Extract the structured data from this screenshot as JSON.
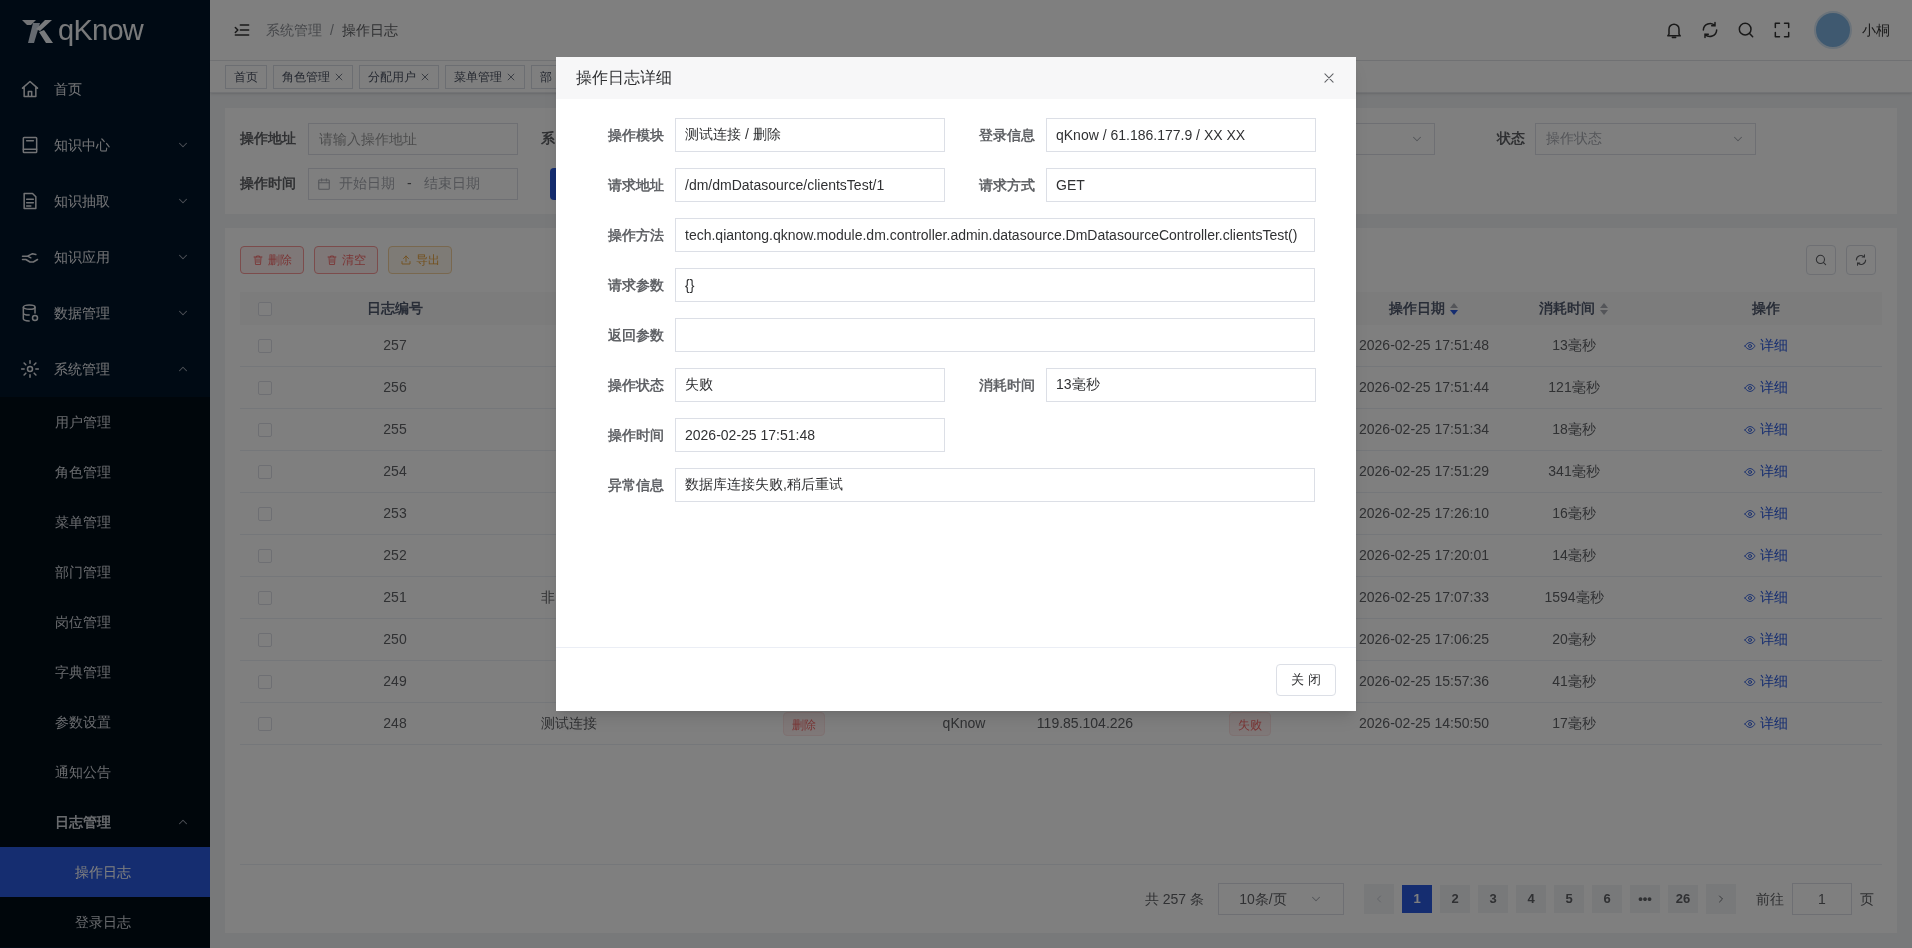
{
  "app": {
    "logo_text": "qKnow"
  },
  "sidebar": {
    "items": [
      {
        "label": "首页",
        "selected": false
      },
      {
        "label": "知识中心",
        "selected": false,
        "expanded": false
      },
      {
        "label": "知识抽取",
        "selected": false,
        "expanded": false
      },
      {
        "label": "知识应用",
        "selected": false,
        "expanded": false
      },
      {
        "label": "数据管理",
        "selected": false,
        "expanded": false
      },
      {
        "label": "系统管理",
        "selected": false,
        "expanded": true,
        "children": [
          {
            "label": "用户管理",
            "selected": false
          },
          {
            "label": "角色管理",
            "selected": false
          },
          {
            "label": "菜单管理",
            "selected": false
          },
          {
            "label": "部门管理",
            "selected": false
          },
          {
            "label": "岗位管理",
            "selected": false
          },
          {
            "label": "字典管理",
            "selected": false
          },
          {
            "label": "参数设置",
            "selected": false
          },
          {
            "label": "通知公告",
            "selected": false
          },
          {
            "label": "日志管理",
            "selected": false,
            "expanded": true,
            "children": [
              {
                "label": "操作日志",
                "selected": true
              },
              {
                "label": "登录日志",
                "selected": false
              }
            ]
          }
        ]
      }
    ]
  },
  "header": {
    "breadcrumb": [
      "系统管理",
      "操作日志"
    ],
    "breadcrumb_separator": "/",
    "user_name": "小桐"
  },
  "tabs": [
    {
      "label": "首页",
      "selected": false,
      "closable": false
    },
    {
      "label": "角色管理",
      "selected": false,
      "closable": true
    },
    {
      "label": "分配用户",
      "selected": false,
      "closable": true
    },
    {
      "label": "菜单管理",
      "selected": false,
      "closable": true
    },
    {
      "label": "部",
      "selected": false,
      "closable": false
    }
  ],
  "filters": {
    "address_label": "操作地址",
    "address_placeholder": "请输入操作地址",
    "column_2_label": "系",
    "status_label": "状态",
    "status_placeholder": "操作状态",
    "time_label": "操作时间",
    "start_placeholder": "开始日期",
    "range_separator": "-",
    "end_placeholder": "结束日期"
  },
  "toolbar": [
    {
      "label": "删除",
      "kind": "danger"
    },
    {
      "label": "清空",
      "kind": "danger"
    },
    {
      "label": "导出",
      "kind": "warning"
    }
  ],
  "table": {
    "select_all_checked": false,
    "columns": [
      {
        "label": "日志编号",
        "sortable": false
      },
      {
        "label": "操作日期",
        "sortable": true,
        "sorted_descending": true
      },
      {
        "label": "消耗时间",
        "sortable": true,
        "sorted_descending": false
      },
      {
        "label": "操作",
        "sortable": false
      }
    ],
    "rows": [
      {
        "checked": false,
        "log_id": "257",
        "date": "2026-02-25 17:51:48",
        "duration": "13毫秒",
        "action": "详细"
      },
      {
        "checked": false,
        "log_id": "256",
        "date": "2026-02-25 17:51:44",
        "duration": "121毫秒",
        "action": "详细"
      },
      {
        "checked": false,
        "log_id": "255",
        "date": "2026-02-25 17:51:34",
        "duration": "18毫秒",
        "action": "详细"
      },
      {
        "checked": false,
        "log_id": "254",
        "date": "2026-02-25 17:51:29",
        "duration": "341毫秒",
        "action": "详细"
      },
      {
        "checked": false,
        "log_id": "253",
        "date": "2026-02-25 17:26:10",
        "duration": "16毫秒",
        "action": "详细"
      },
      {
        "checked": false,
        "log_id": "252",
        "date": "2026-02-25 17:20:01",
        "duration": "14毫秒",
        "action": "详细"
      },
      {
        "checked": false,
        "log_id": "251",
        "column_2": "非",
        "date": "2026-02-25 17:07:33",
        "duration": "1594毫秒",
        "action": "详细"
      },
      {
        "checked": false,
        "log_id": "250",
        "date": "2026-02-25 17:06:25",
        "duration": "20毫秒",
        "action": "详细"
      },
      {
        "checked": false,
        "log_id": "249",
        "date": "2026-02-25 15:57:36",
        "duration": "41毫秒",
        "action": "详细"
      },
      {
        "checked": false,
        "log_id": "248",
        "column_2": "测试连接",
        "column_3": "删除",
        "column_4": "qKnow",
        "column_5": "119.85.104.226",
        "column_6": "失败",
        "date": "2026-02-25 14:50:50",
        "duration": "17毫秒",
        "action": "详细"
      }
    ]
  },
  "pagination": {
    "total": "共 257 条",
    "page_size": "10条/页",
    "pages": [
      {
        "label": "1",
        "selected": true
      },
      {
        "label": "2",
        "selected": false
      },
      {
        "label": "3",
        "selected": false
      },
      {
        "label": "4",
        "selected": false
      },
      {
        "label": "5",
        "selected": false
      },
      {
        "label": "6",
        "selected": false
      },
      {
        "label": "•••",
        "selected": false
      },
      {
        "label": "26",
        "selected": false
      }
    ],
    "goto_label": "前往",
    "goto_value": "1",
    "page_suffix": "页"
  },
  "dialog": {
    "title": "操作日志详细",
    "close_button": "关 闭",
    "fields": [
      {
        "label": "操作模块",
        "value": "测试连接 / 删除",
        "kind": "half"
      },
      {
        "label": "登录信息",
        "value": "qKnow / 61.186.177.9 / XX XX",
        "kind": "half"
      },
      {
        "label": "请求地址",
        "value": "/dm/dmDatasource/clientsTest/1",
        "kind": "half"
      },
      {
        "label": "请求方式",
        "value": "GET",
        "kind": "half"
      },
      {
        "label": "操作方法",
        "value": "tech.qiantong.qknow.module.dm.controller.admin.datasource.DmDatasourceController.clientsTest()",
        "kind": "full"
      },
      {
        "label": "请求参数",
        "value": "{}",
        "kind": "full"
      },
      {
        "label": "返回参数",
        "kind": "full"
      },
      {
        "label": "操作状态",
        "value": "失败",
        "kind": "half"
      },
      {
        "label": "消耗时间",
        "value": "13毫秒",
        "kind": "half"
      },
      {
        "label": "操作时间",
        "value": "2026-02-25 17:51:48",
        "kind": "half"
      },
      {
        "label": "异常信息",
        "value": "数据库连接失败,稍后重试",
        "kind": "full"
      }
    ]
  }
}
